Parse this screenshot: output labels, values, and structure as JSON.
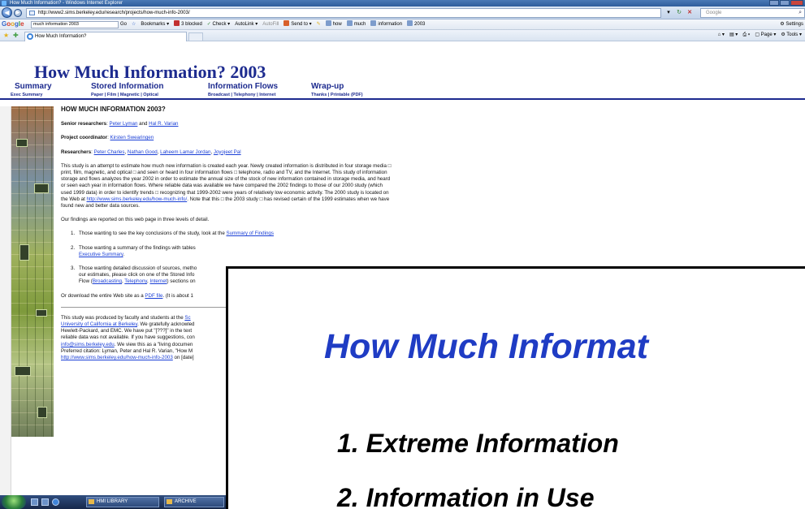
{
  "browser": {
    "window_title": "How Much Information? - Windows Internet Explorer",
    "url": "http://www2.sims.berkeley.edu/research/projects/how-much-info-2003/",
    "search_placeholder": "Google",
    "tab_title": "How Much Information?",
    "google_bar": {
      "logo": "Google",
      "query": "much information 2003",
      "go": "Go",
      "bookmarks": "Bookmarks",
      "blocked": "3 blocked",
      "check": "Check",
      "autolink": "AutoLink",
      "autofill": "AutoFill",
      "send_to": "Send to",
      "words": [
        "how",
        "much",
        "information",
        "2003"
      ],
      "settings": "Settings"
    },
    "command_bar": {
      "page": "Page",
      "tools": "Tools"
    }
  },
  "site": {
    "title": "How Much Information? 2003",
    "menu": {
      "summary": "Summary",
      "stored": "Stored Information",
      "flows": "Information Flows",
      "wrapup": "Wrap-up"
    },
    "submenu": {
      "exec_summary": "Exec Summary",
      "paper": "Paper",
      "film": "Film",
      "magnetic": "Magnetic",
      "optical": "Optical",
      "broadcast": "Broadcast",
      "telephony": "Telephony",
      "internet": "Internet",
      "thanks": "Thanks",
      "printable": "Printable",
      "pdf": "(PDF)",
      "sep": " | "
    }
  },
  "content": {
    "heading": "HOW MUCH INFORMATION 2003?",
    "senior_label": "Senior researchers",
    "senior_1": "Peter Lyman",
    "senior_and": " and ",
    "senior_2": "Hal R. Varian",
    "coordinator_label": "Project coordinator",
    "coordinator": "Kirsten Swearingen",
    "researchers_label": "Researchers",
    "researcher_1": "Peter Charles",
    "researcher_2": "Nathan Good",
    "researcher_3": "Laheem Lamar Jordan",
    "researcher_4": "Joyojeet Pal",
    "sep_comma": ", ",
    "colon": ": ",
    "intro_part1": "This study is an attempt to estimate how much new information is created each year. Newly created information is distributed in four storage media □ print, film, magnetic, and optical □ and seen or heard in four information flows □ telephone, radio and TV, and the Internet. This study of information storage and flows analyzes the year 2002 in order to estimate the annual size of the stock of new information contained in storage media, and heard or seen each year in information flows. Where reliable data was available we have compared the 2002 findings to those of our 2000 study (which used 1999 data) in order to identify trends □ recognizing that 1999-2002 were years of relatively low economic activity. The 2000 study is located on the Web at ",
    "intro_link": "http://www.sims.berkeley.edu/how-much-info/",
    "intro_part2": ". Note that this □ the 2003 study □ has revised certain of the 1999 estimates when we have found new and better data sources.",
    "levels_intro": "Our findings are reported on this web page in three levels of detail.",
    "item1_num": "1.",
    "item1_text": "Those wanting to see the key conclusions of the study, look at the ",
    "item1_link": "Summary of Findings",
    "item2_num": "2.",
    "item2_text": "Those wanting a summary of the findings with tables",
    "item2_link": "Executive Summary",
    "item2_end": ".",
    "item3_num": "3.",
    "item3_text1": "Those wanting detailed discussion of sources, metho",
    "item3_text2": "our estimates, please click on one of the Stored Info",
    "item3_text3": "Flow (",
    "item3_link1": "Broadcasting",
    "item3_link2": "Telephony",
    "item3_link3": "Internet",
    "item3_text4": ") sections on",
    "download_text": "Or download the entire Web site as a ",
    "download_link": "PDF file",
    "download_end": ". (It is about 1",
    "footer_1": "This study was produced by faculty and students at the ",
    "footer_link1": "Sc",
    "footer_link2": "University of California at Berkeley",
    "footer_2": ". We gratefully acknowled",
    "footer_3": "Hewlett-Packard, and EMC. We have put \"[???]\" in the text",
    "footer_4": "reliable data was not available. If you have suggestions, con",
    "footer_link3": "info@sims.berkeley.edu",
    "footer_5": ". We view this as a \"living documen",
    "footer_6": "Preferred citation: Lyman, Peter and Hal R. Varian, \"How M",
    "footer_link4": "http://www.sims.berkeley.edu/how-much-info-2003",
    "footer_7": " on [date]"
  },
  "slide": {
    "title": "How Much Informat",
    "items": [
      "1.  Extreme Information",
      "2.  Information in Use"
    ]
  },
  "taskbar": {
    "buttons": [
      "HMI LIBRARY",
      "ARCHIVE"
    ]
  },
  "colors": {
    "site_blue": "#1d2b8f",
    "link_blue": "#1a3fd6",
    "slide_title_blue": "#1f3cc4"
  }
}
